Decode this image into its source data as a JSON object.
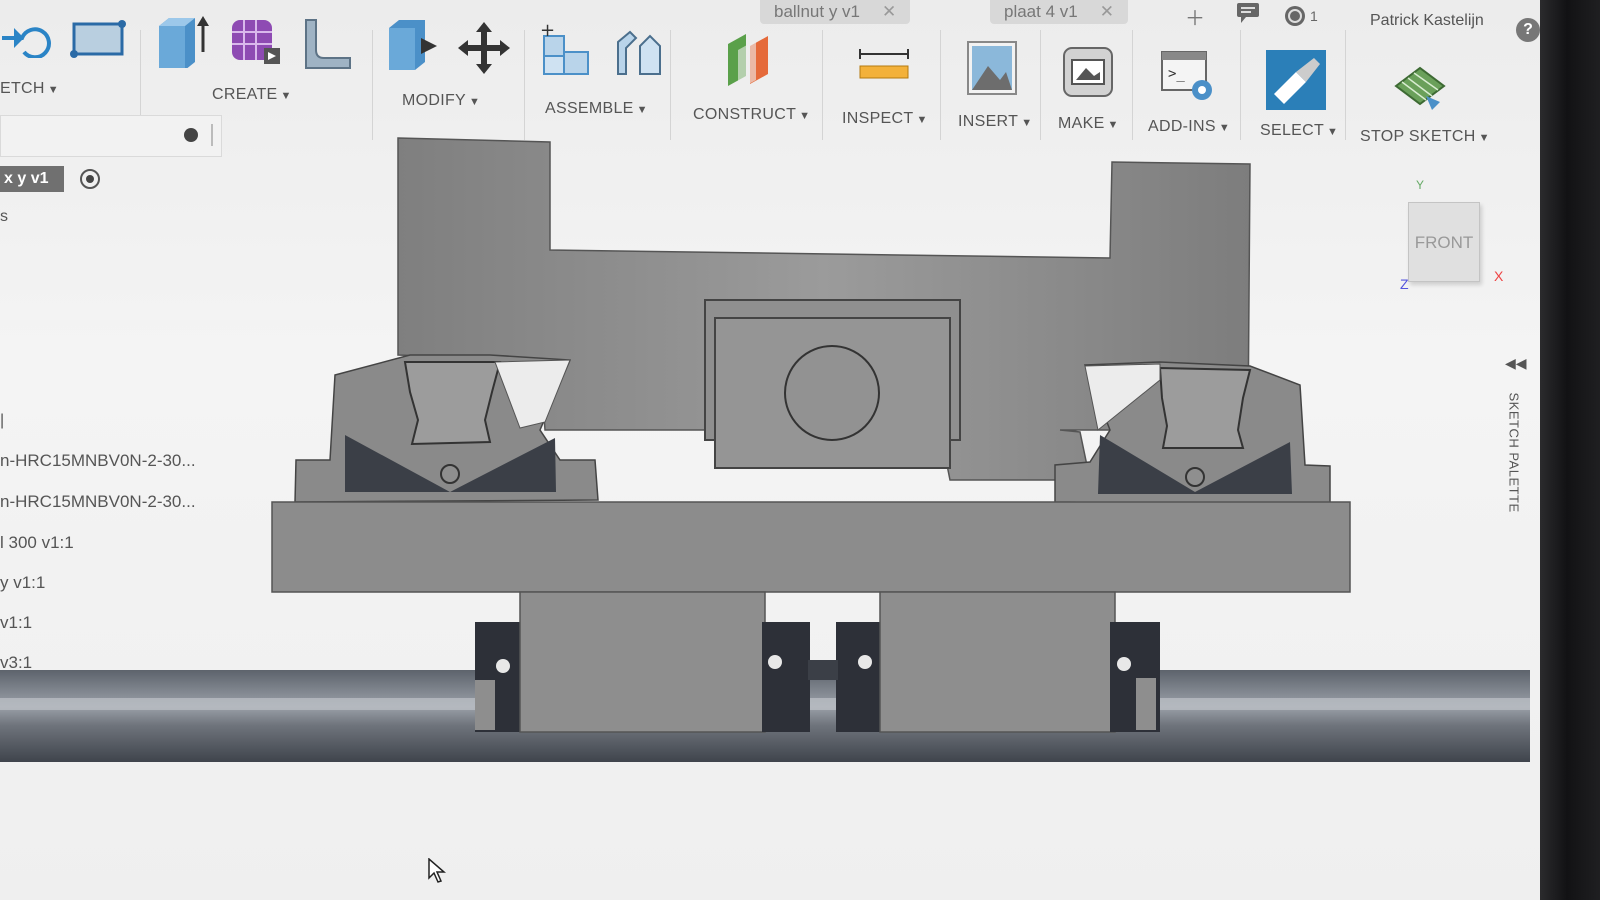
{
  "tabs": [
    {
      "label": "ballnut y v1"
    },
    {
      "label": "plaat 4 v1"
    }
  ],
  "top_bar": {
    "job_count": "1",
    "user_name": "Patrick Kastelijn",
    "help": "?"
  },
  "toolbar": {
    "groups": [
      {
        "label": "ETCH"
      },
      {
        "label": "CREATE"
      },
      {
        "label": "MODIFY"
      },
      {
        "label": "ASSEMBLE"
      },
      {
        "label": "CONSTRUCT"
      },
      {
        "label": "INSPECT"
      },
      {
        "label": "INSERT"
      },
      {
        "label": "MAKE"
      },
      {
        "label": "ADD-INS"
      },
      {
        "label": "SELECT"
      },
      {
        "label": "STOP SKETCH"
      }
    ],
    "caret": "▼"
  },
  "browser": {
    "root_label": "x y v1",
    "s_label": "s",
    "items": [
      {
        "label": "n-HRC15MNBV0N-2-30..."
      },
      {
        "label": "n-HRC15MNBV0N-2-30..."
      },
      {
        "label": "l 300 v1:1"
      },
      {
        "label": "y v1:1"
      },
      {
        "label": "v1:1"
      },
      {
        "label": "v3:1"
      }
    ]
  },
  "sketch_palette": {
    "label": "SKETCH PALETTE",
    "chevron": "◀◀"
  },
  "viewcube": {
    "face": "FRONT",
    "axis_x": "X",
    "axis_y": "Y",
    "axis_z": "Z"
  },
  "colors": {
    "accent_select": "#2b7fb8",
    "part_fill": "#8d8d8d",
    "rail_dark": "#3a3d44",
    "background": "#efefef"
  },
  "icons": [
    "undo-icon",
    "rectangle-icon",
    "extrude-icon",
    "mesh-icon",
    "fillet-icon",
    "press-pull-icon",
    "move-icon",
    "new-component-icon",
    "joint-icon",
    "construct-plane-icon",
    "measure-icon",
    "insert-image-icon",
    "make-3dprint-icon",
    "scripts-icon",
    "select-icon",
    "stop-sketch-icon"
  ]
}
